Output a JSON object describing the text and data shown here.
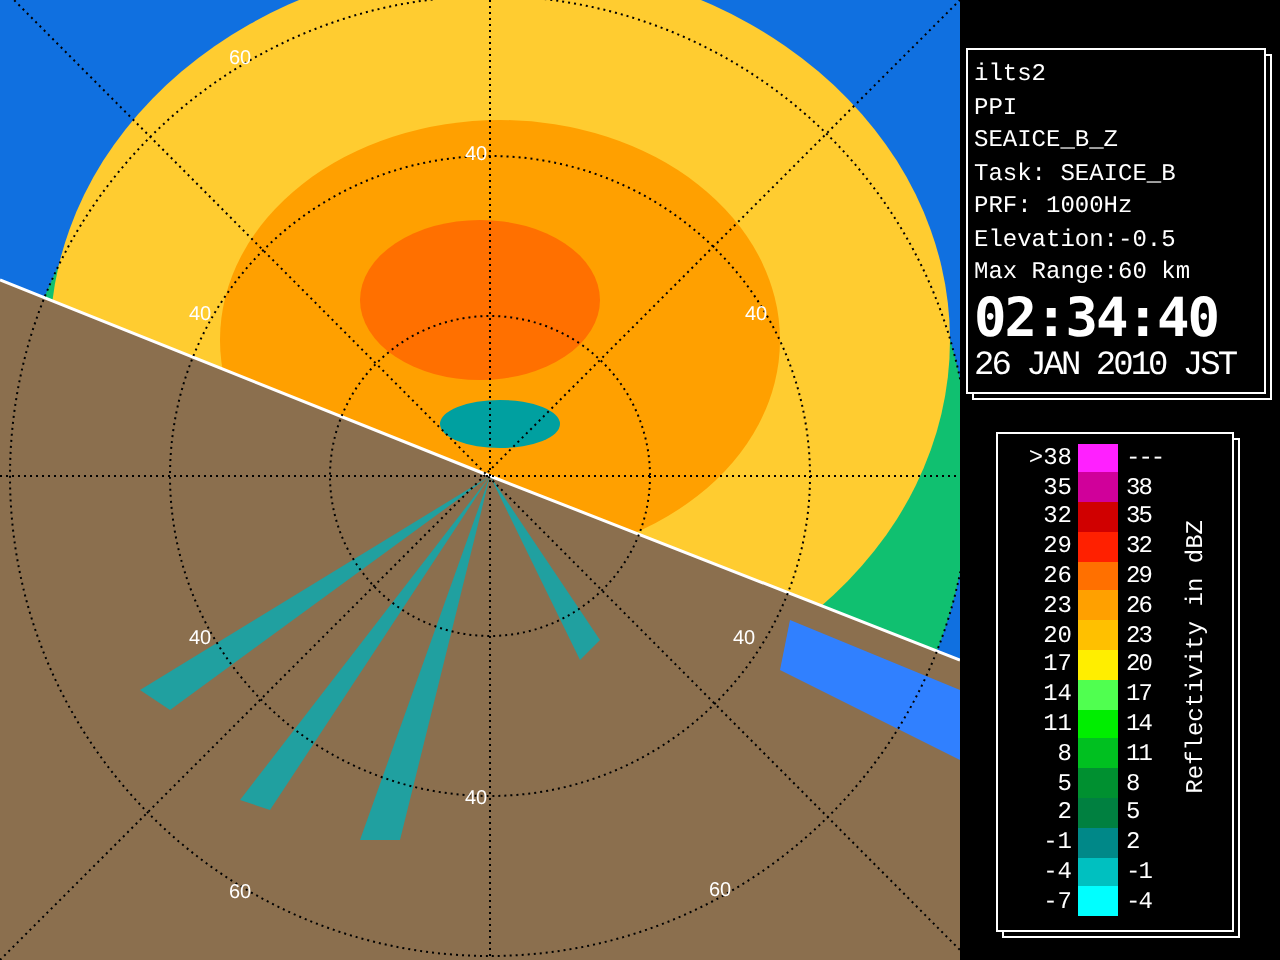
{
  "map": {
    "range_labels": [
      "60",
      "40",
      "40",
      "40",
      "40",
      "40",
      "40",
      "60",
      "60"
    ]
  },
  "info": {
    "lines": [
      "ilts2",
      "PPI",
      "SEAICE_B_Z",
      "Task: SEAICE_B",
      "PRF: 1000Hz",
      "Elevation:-0.5",
      "Max Range:60 km"
    ],
    "time": "02:34:40",
    "date": "26 JAN 2010 JST"
  },
  "legend": {
    "title": "Reflectivity in dBZ",
    "rows": [
      {
        "low": ">38",
        "high": "---",
        "color": "#ff20ff"
      },
      {
        "low": "35",
        "high": "38",
        "color": "#d0009a"
      },
      {
        "low": "32",
        "high": "35",
        "color": "#d00000"
      },
      {
        "low": "29",
        "high": "32",
        "color": "#ff2000"
      },
      {
        "low": "26",
        "high": "29",
        "color": "#ff7000"
      },
      {
        "low": "23",
        "high": "26",
        "color": "#ffa000"
      },
      {
        "low": "20",
        "high": "23",
        "color": "#ffc000"
      },
      {
        "low": "17",
        "high": "20",
        "color": "#ffee00"
      },
      {
        "low": "14",
        "high": "17",
        "color": "#50ff50"
      },
      {
        "low": "11",
        "high": "14",
        "color": "#00ee00"
      },
      {
        "low": "8",
        "high": "11",
        "color": "#00c020"
      },
      {
        "low": "5",
        "high": "8",
        "color": "#009030"
      },
      {
        "low": "2",
        "high": "5",
        "color": "#008040"
      },
      {
        "low": "-1",
        "high": "2",
        "color": "#008888"
      },
      {
        "low": "-4",
        "high": "-1",
        "color": "#00c0c0"
      },
      {
        "low": "-7",
        "high": "-4",
        "color": "#00ffff"
      }
    ]
  }
}
